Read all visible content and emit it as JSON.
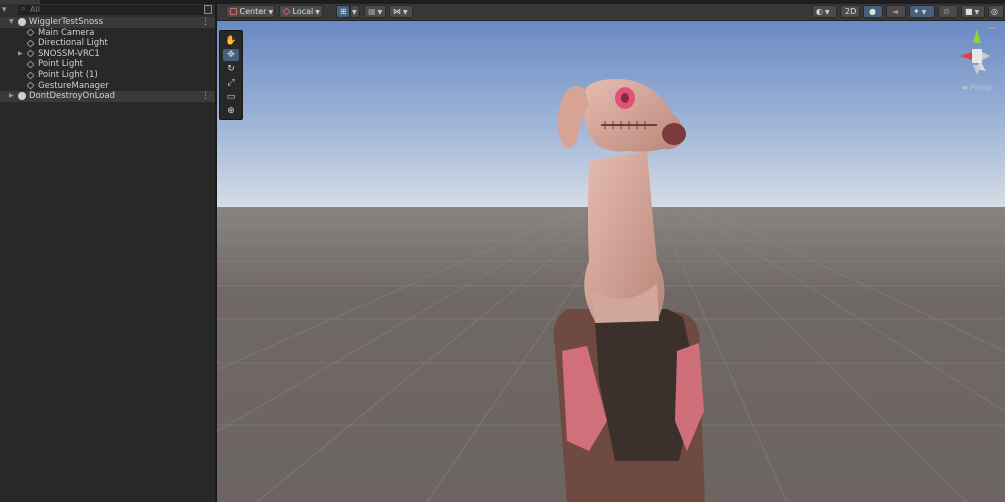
{
  "hierarchy": {
    "search_placeholder": "All",
    "rows": [
      {
        "label": "WigglerTestSnoss",
        "kind": "scene"
      },
      {
        "label": "Main Camera",
        "kind": "object"
      },
      {
        "label": "Directional Light",
        "kind": "object"
      },
      {
        "label": "SNOSSM-VRC1",
        "kind": "prefab"
      },
      {
        "label": "Point Light",
        "kind": "object"
      },
      {
        "label": "Point Light (1)",
        "kind": "object"
      },
      {
        "label": "GestureManager",
        "kind": "object"
      },
      {
        "label": "DontDestroyOnLoad",
        "kind": "scene"
      }
    ]
  },
  "scene_toolbar": {
    "pivot_label": "Center",
    "space_label": "Local",
    "mode_2d_label": "2D"
  },
  "scene_view": {
    "projection_label": "Persp",
    "tools": [
      "hand-tool",
      "move-tool",
      "rotate-tool",
      "scale-tool",
      "rect-tool",
      "transform-tool"
    ],
    "active_tool": "move-tool"
  },
  "colors": {
    "accent": "#46607c",
    "panel": "#282828",
    "toolbar": "#383838",
    "sky_top": "#6f8fc7",
    "ground": "#6a625e"
  }
}
